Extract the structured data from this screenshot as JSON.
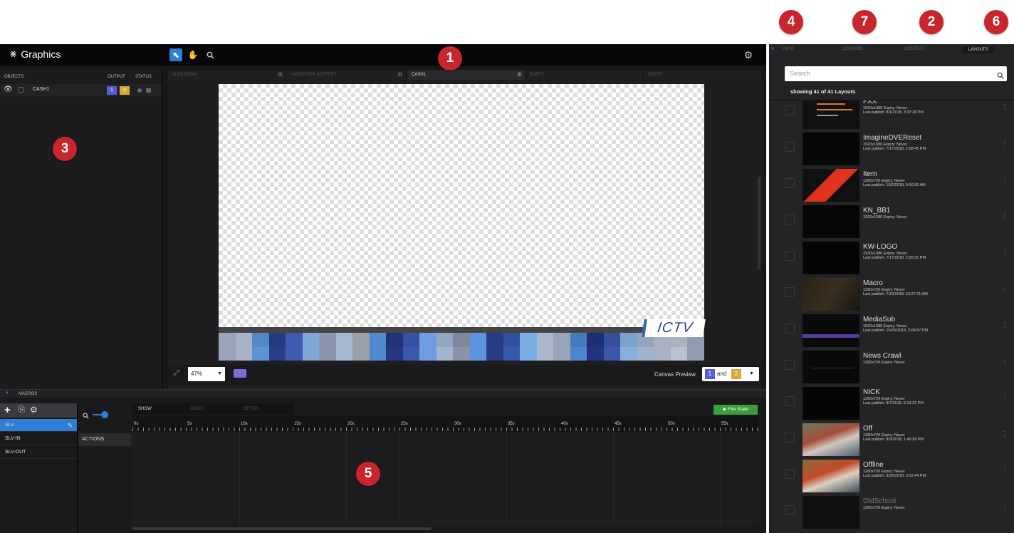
{
  "app": {
    "title": "Graphics",
    "callouts": [
      "1",
      "3",
      "4",
      "7",
      "2",
      "6",
      "5"
    ]
  },
  "objects_panel": {
    "col_objects": "OBJECTS",
    "col_output": "OUTPUT",
    "col_status": "STATUS",
    "row": {
      "name": "CASH1",
      "out1": "1",
      "out2": "2"
    }
  },
  "layers": [
    {
      "label": "SLEDSHOW",
      "active": false
    },
    {
      "label": "HANDTREPLACETEST",
      "active": false
    },
    {
      "label": "CASH1",
      "active": true
    },
    {
      "label": "EMPTY",
      "active": false
    },
    {
      "label": "EMPTY",
      "active": false
    }
  ],
  "canvas": {
    "logo_text": "ICTV",
    "zoom": "47%",
    "preview_label": "Canvas Preview",
    "preview_ch1": "1",
    "preview_and": "and",
    "preview_ch2": "2"
  },
  "macros": {
    "header": "MACROS",
    "items": [
      "SLV",
      "SLV-IN",
      "SLV-OUT"
    ],
    "tabs": [
      "SHOW",
      "DONE",
      "SETUP"
    ],
    "fire_state": "▶ Fire State",
    "actions": "ACTIONS",
    "ticks": [
      "0s",
      "5s",
      "10s",
      "15s",
      "20s",
      "25s",
      "30s",
      "35s",
      "40s",
      "45s",
      "50s",
      "55s"
    ]
  },
  "right_panel": {
    "tabs": [
      "INFO",
      "CONTROL",
      "CONTENT",
      "LAYOUTS"
    ],
    "active_tab": "LAYOUTS",
    "search_placeholder": "Search",
    "showing": "showing 41 of 41 Layouts",
    "layouts": [
      {
        "name": "FXX",
        "meta1": "1920x1080  Expiry: Never",
        "meta2": "Last publish: 8/1/2018, 3:37:28 PM"
      },
      {
        "name": "ImagineDVEReset",
        "meta1": "1920x1080  Expiry: Never",
        "meta2": "Last publish: 7/17/2018, 2:08:41 PM"
      },
      {
        "name": "Item",
        "meta1": "1280x720  Expiry: Never",
        "meta2": "Last publish: 10/2/2018, 9:50:30 AM"
      },
      {
        "name": "KN_BB1",
        "meta1": "1920x1080  Expiry: Never",
        "meta2": ""
      },
      {
        "name": "KW-LOGO",
        "meta1": "1920x1080  Expiry: Never",
        "meta2": "Last publish: 7/17/2018, 2:05:31 PM"
      },
      {
        "name": "Macro",
        "meta1": "1280x720  Expiry: Never",
        "meta2": "Last publish: 7/19/2018, 10:27:01 AM"
      },
      {
        "name": "MediaSub",
        "meta1": "1920x1080  Expiry: Never",
        "meta2": "Last publish: 10/25/2018, 3:08:57 PM"
      },
      {
        "name": "News Crawl",
        "meta1": "1280x720  Expiry: Never",
        "meta2": ""
      },
      {
        "name": "NICK",
        "meta1": "1280x720  Expiry: Never",
        "meta2": "Last publish: 9/7/2018, 5:13:22 PM"
      },
      {
        "name": "Off",
        "meta1": "1280x720  Expiry: Never",
        "meta2": "Last publish: 8/3/2018, 1:40:39 PM"
      },
      {
        "name": "Offline",
        "meta1": "1280x720  Expiry: Never",
        "meta2": "Last publish: 9/28/2018, 3:02:44 PM"
      },
      {
        "name": "OldSchool",
        "meta1": "1280x720  Expiry: Never",
        "meta2": ""
      }
    ]
  },
  "colors": {
    "accent": "#2d7fd6",
    "badge": "#c8252c",
    "output1": "#5560d8",
    "output2": "#d9a73a",
    "fire": "#3aa13a"
  }
}
